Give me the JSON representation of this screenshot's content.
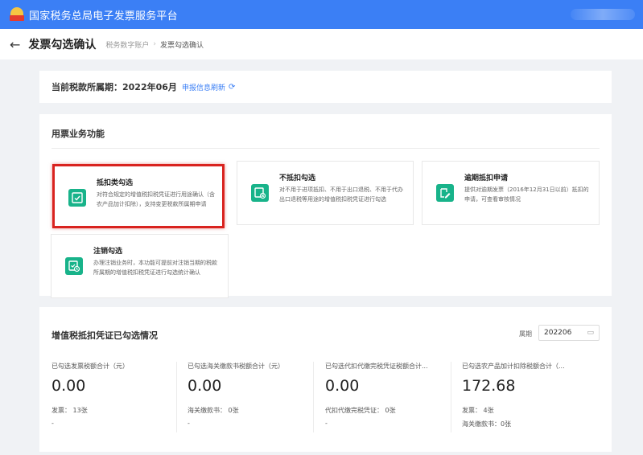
{
  "app": {
    "title": "国家税务总局电子发票服务平台"
  },
  "page": {
    "back_glyph": "←",
    "title": "发票勾选确认",
    "breadcrumb": [
      "税务数字账户",
      "发票勾选确认"
    ],
    "breadcrumb_sep": "›"
  },
  "period": {
    "label": "当前税款所属期：",
    "value": "2022年06月",
    "refresh_label": "申报信息刷新",
    "refresh_icon": "refresh-icon",
    "refresh_glyph": "⟳"
  },
  "functions": {
    "heading": "用票业务功能",
    "items": [
      {
        "title": "抵扣类勾选",
        "desc": "对符合规定的增值税扣税凭证进行用途确认（含农产品加计扣除），支持变更税款所属期申请",
        "icon": "deduct-check-icon",
        "selected": true
      },
      {
        "title": "不抵扣勾选",
        "desc": "对不用于进项抵扣、不用于出口退税、不用于代办出口退税等用途的增值税扣税凭证进行勾选",
        "icon": "non-deduct-icon",
        "selected": false
      },
      {
        "title": "逾期抵扣申请",
        "desc": "提供对逾期发票（2016年12月31日以前）抵扣的申请，可查看审核情况",
        "icon": "overdue-apply-icon",
        "selected": false
      },
      {
        "title": "注销勾选",
        "desc": "办理注销业务时，本功能可提前对注销当期的税款所属期的增值税扣税凭证进行勾选统计确认",
        "icon": "cancel-check-icon",
        "selected": false
      }
    ]
  },
  "certificates": {
    "heading": "增值税抵扣凭证已勾选情况",
    "period_label": "属期",
    "period_value": "202206",
    "calendar_glyph": "▭",
    "stats": [
      {
        "label": "已勾选发票税额合计（元）",
        "value": "0.00",
        "detail": "发票：  13张",
        "detail2": "-"
      },
      {
        "label": "已勾选海关缴款书税额合计（元）",
        "value": "0.00",
        "detail": "海关缴款书：  0张",
        "detail2": "-"
      },
      {
        "label": "已勾选代扣代缴完税凭证税额合计...",
        "value": "0.00",
        "detail": "代扣代缴完税凭证：  0张",
        "detail2": "-"
      },
      {
        "label": "已勾选农产品加计扣除税额合计（...",
        "value": "172.68",
        "detail": "发票：  4张",
        "detail2": "海关缴款书：0张"
      }
    ]
  },
  "colors": {
    "header_bg": "#3b7ff5",
    "accent": "#3b7ff5",
    "icon_green": "#18b38a",
    "highlight_red": "#d9231f"
  }
}
